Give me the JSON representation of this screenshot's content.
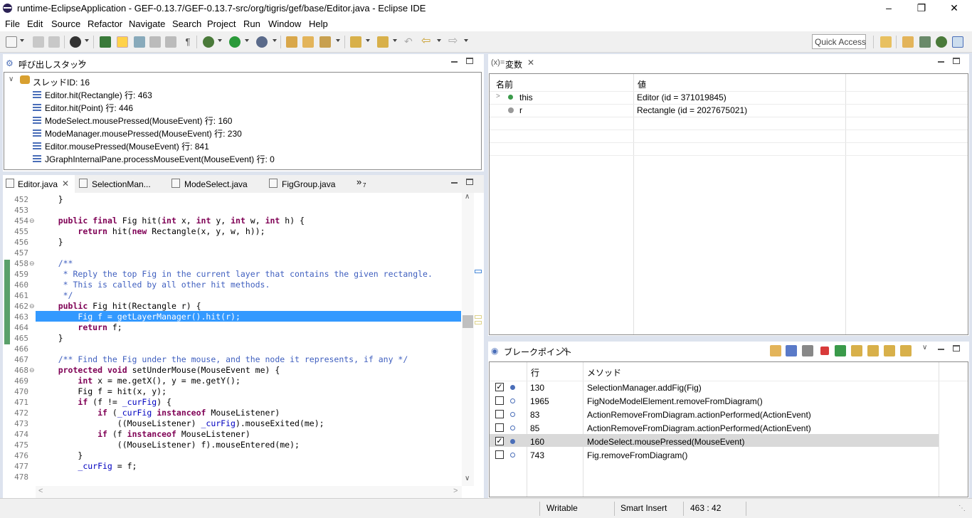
{
  "window": {
    "title": "runtime-EclipseApplication - GEF-0.13.7/GEF-0.13.7-src/org/tigris/gef/base/Editor.java - Eclipse IDE"
  },
  "menu": [
    "File",
    "Edit",
    "Source",
    "Refactor",
    "Navigate",
    "Search",
    "Project",
    "Run",
    "Window",
    "Help"
  ],
  "toolbar": {
    "quick_access": "Quick Access"
  },
  "callstack": {
    "title": "呼び出しスタック",
    "thread": "スレッドID: 16",
    "frames": [
      "Editor.hit(Rectangle) 行: 463",
      "Editor.hit(Point) 行: 446",
      "ModeSelect.mousePressed(MouseEvent) 行: 160",
      "ModeManager.mousePressed(MouseEvent) 行: 230",
      "Editor.mousePressed(MouseEvent) 行: 841",
      "JGraphInternalPane.processMouseEvent(MouseEvent) 行: 0"
    ]
  },
  "editor": {
    "tabs": [
      "Editor.java",
      "SelectionMan...",
      "ModeSelect.java",
      "FigGroup.java"
    ],
    "overflow": "»",
    "overflow_count": "7",
    "lines": [
      {
        "n": "452",
        "code": "    }"
      },
      {
        "n": "453",
        "code": ""
      },
      {
        "n": "454",
        "code": "    public final Fig hit(int x, int y, int w, int h) {"
      },
      {
        "n": "455",
        "code": "        return hit(new Rectangle(x, y, w, h));"
      },
      {
        "n": "456",
        "code": "    }"
      },
      {
        "n": "457",
        "code": ""
      },
      {
        "n": "458",
        "code": "    /**"
      },
      {
        "n": "459",
        "code": "     * Reply the top Fig in the current layer that contains the given rectangle."
      },
      {
        "n": "460",
        "code": "     * This is called by all other hit methods."
      },
      {
        "n": "461",
        "code": "     */"
      },
      {
        "n": "462",
        "code": "    public Fig hit(Rectangle r) {"
      },
      {
        "n": "463",
        "code": "        Fig f = getLayerManager().hit(r);"
      },
      {
        "n": "464",
        "code": "        return f;"
      },
      {
        "n": "465",
        "code": "    }"
      },
      {
        "n": "466",
        "code": ""
      },
      {
        "n": "467",
        "code": "    /** Find the Fig under the mouse, and the node it represents, if any */"
      },
      {
        "n": "468",
        "code": "    protected void setUnderMouse(MouseEvent me) {"
      },
      {
        "n": "469",
        "code": "        int x = me.getX(), y = me.getY();"
      },
      {
        "n": "470",
        "code": "        Fig f = hit(x, y);"
      },
      {
        "n": "471",
        "code": "        if (f != _curFig) {"
      },
      {
        "n": "472",
        "code": "            if (_curFig instanceof MouseListener)"
      },
      {
        "n": "473",
        "code": "                ((MouseListener) _curFig).mouseExited(me);"
      },
      {
        "n": "474",
        "code": "            if (f instanceof MouseListener)"
      },
      {
        "n": "475",
        "code": "                ((MouseListener) f).mouseEntered(me);"
      },
      {
        "n": "476",
        "code": "        }"
      },
      {
        "n": "477",
        "code": "        _curFig = f;"
      },
      {
        "n": "478",
        "code": ""
      }
    ]
  },
  "variables": {
    "title": "変数",
    "prefix": "(x)=",
    "col_name": "名前",
    "col_value": "値",
    "rows": [
      {
        "name": "this",
        "value": "Editor (id = 371019845)"
      },
      {
        "name": "r",
        "value": "Rectangle (id = 2027675021)"
      }
    ]
  },
  "breakpoints": {
    "title": "ブレークポイント",
    "col_line": "行",
    "col_method": "メソッド",
    "rows": [
      {
        "checked": "✓",
        "line": "130",
        "method": "SelectionManager.addFig(Fig)"
      },
      {
        "checked": "",
        "line": "1965",
        "method": "FigNodeModelElement.removeFromDiagram()"
      },
      {
        "checked": "",
        "line": "83",
        "method": "ActionRemoveFromDiagram.actionPerformed(ActionEvent)"
      },
      {
        "checked": "",
        "line": "85",
        "method": "ActionRemoveFromDiagram.actionPerformed(ActionEvent)"
      },
      {
        "checked": "✓",
        "line": "160",
        "method": "ModeSelect.mousePressed(MouseEvent)"
      },
      {
        "checked": "",
        "line": "743",
        "method": "Fig.removeFromDiagram()"
      }
    ]
  },
  "status": {
    "writable": "Writable",
    "insert": "Smart Insert",
    "position": "463 : 42"
  },
  "colors": {
    "keyword": "#7f0055",
    "comment": "#3f5fbf",
    "field": "#0000c0",
    "selection": "#3399ff",
    "panel_bg": "#dde3ee"
  }
}
